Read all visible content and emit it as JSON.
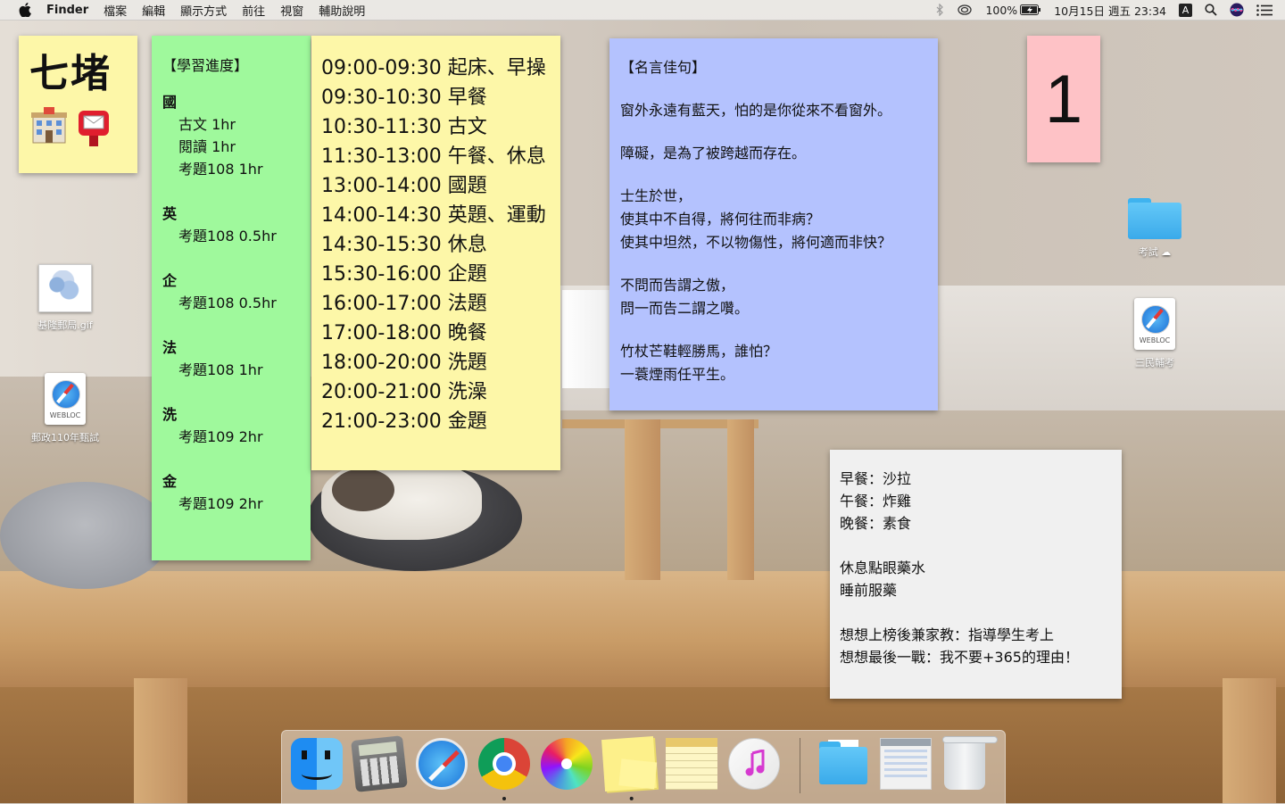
{
  "menubar": {
    "app_name": "Finder",
    "menus": [
      "檔案",
      "編輯",
      "顯示方式",
      "前往",
      "視窗",
      "輔助說明"
    ],
    "battery_percent": "100%",
    "datetime": "10月15日 週五 23:34",
    "input_badge": "A"
  },
  "stickies": {
    "location": {
      "title": "七堵",
      "emojis": [
        "🏣",
        "📮"
      ]
    },
    "progress": {
      "title": "【學習進度】",
      "sections": [
        {
          "head": "國",
          "lines": [
            "古文 1hr",
            "閱讀 1hr",
            "考題108 1hr"
          ]
        },
        {
          "head": "英",
          "lines": [
            "考題108 0.5hr"
          ]
        },
        {
          "head": "企",
          "lines": [
            "考題108 0.5hr"
          ]
        },
        {
          "head": "法",
          "lines": [
            "考題108 1hr"
          ]
        },
        {
          "head": "洗",
          "lines": [
            "考題109 2hr"
          ]
        },
        {
          "head": "金",
          "lines": [
            "考題109 2hr"
          ]
        }
      ]
    },
    "schedule": [
      "09:00-09:30 起床、早操",
      "09:30-10:30 早餐",
      "10:30-11:30 古文",
      "11:30-13:00 午餐、休息",
      "13:00-14:00 國題",
      "14:00-14:30 英題、運動",
      "14:30-15:30 休息",
      "15:30-16:00 企題",
      "16:00-17:00 法題",
      "17:00-18:00 晚餐",
      "18:00-20:00 洗題",
      "20:00-21:00 洗澡",
      "21:00-23:00 金題"
    ],
    "quotes": {
      "title": "【名言佳句】",
      "groups": [
        [
          "窗外永遠有藍天，怕的是你從來不看窗外。"
        ],
        [
          "障礙，是為了被跨越而存在。"
        ],
        [
          "士生於世，",
          "使其中不自得，將何往而非病？",
          "使其中坦然，不以物傷性，將何適而非快？"
        ],
        [
          "不問而告謂之傲，",
          "問一而告二謂之囋。"
        ],
        [
          "竹杖芒鞋輕勝馬，誰怕？",
          "一蓑煙雨任平生。"
        ]
      ]
    },
    "counter": "1",
    "notes": {
      "groups": [
        [
          "早餐：沙拉",
          "午餐：炸雞",
          "晚餐：素食"
        ],
        [
          "休息點眼藥水",
          "睡前服藥"
        ],
        [
          "想想上榜後兼家教：指導學生考上",
          "想想最後一戰：我不要+365的理由！"
        ]
      ]
    }
  },
  "desktop_icons": {
    "map_gif": "基隆郵局.gif",
    "webloc_left": "郵政110年甄試",
    "webloc_tag": "WEBLOC",
    "folder_exam": "考試",
    "webloc_right": "三民輔考"
  },
  "dock": {
    "apps": [
      "Finder",
      "Calculator",
      "Safari",
      "Chrome",
      "Photos",
      "Stickies",
      "Notes",
      "iTunes",
      "Downloads",
      "Preview",
      "Trash"
    ]
  },
  "colors": {
    "sticky_yellow": "#fdf7a8",
    "sticky_green": "#9ff99c",
    "sticky_blue": "#b4c2fe",
    "sticky_pink": "#fec2c6",
    "sticky_gray": "#f0f0f0"
  }
}
